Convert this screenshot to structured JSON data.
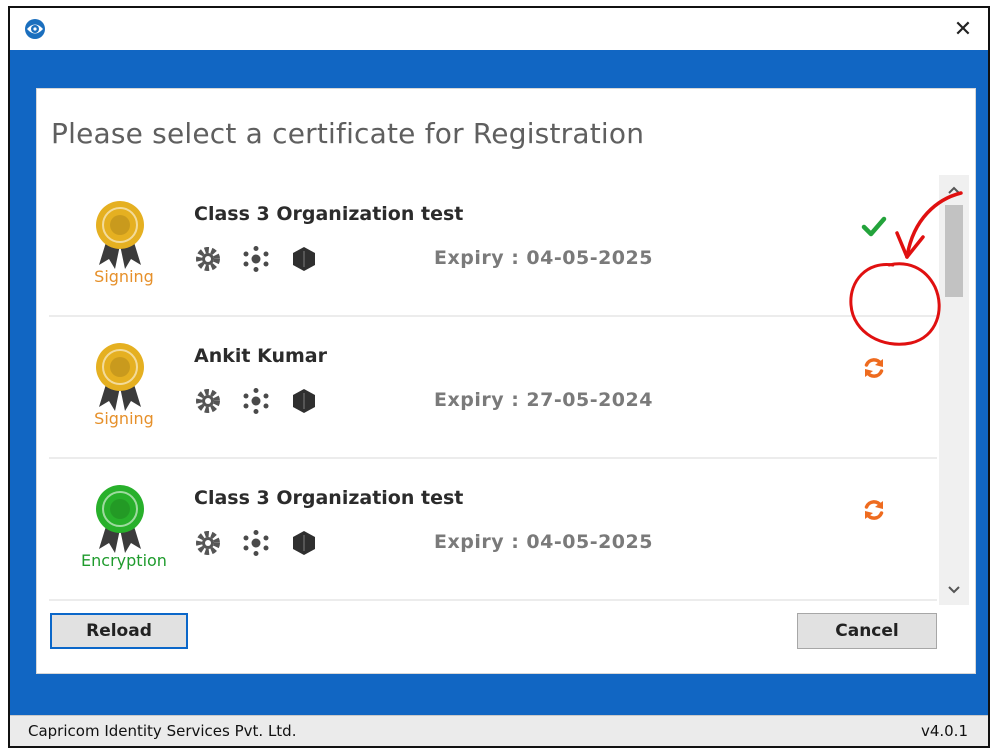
{
  "window": {
    "close_glyph": "✕"
  },
  "dialog": {
    "title": "Please select a certificate for Registration",
    "reload_label": "Reload",
    "cancel_label": "Cancel"
  },
  "certificates": [
    {
      "name": "Class 3 Organization test",
      "type": "Signing",
      "expiry": "Expiry : 04-05-2025",
      "status": "selected",
      "badge_color": "#e5b021",
      "label_color": "#e6902a"
    },
    {
      "name": "Ankit Kumar",
      "type": "Signing",
      "expiry": "Expiry : 27-05-2024",
      "status": "refresh",
      "badge_color": "#e5b021",
      "label_color": "#e6902a"
    },
    {
      "name": "Class 3 Organization test",
      "type": "Encryption",
      "expiry": "Expiry : 04-05-2025",
      "status": "refresh",
      "badge_color": "#28b02b",
      "label_color": "#1f9b2d"
    }
  ],
  "icons": {
    "row_icons": [
      "settings-gear-icon",
      "molecule-icon",
      "shield-hexagon-icon"
    ],
    "selected_status": "checkmark-icon",
    "refresh_status": "refresh-icon"
  },
  "statusbar": {
    "company": "Capricom Identity Services Pvt. Ltd.",
    "version": "v4.0.1"
  },
  "colors": {
    "accent_blue": "#1166c3",
    "check_green": "#23a33b",
    "refresh_orange": "#ee6b1f",
    "annotation_red": "#e01010"
  }
}
